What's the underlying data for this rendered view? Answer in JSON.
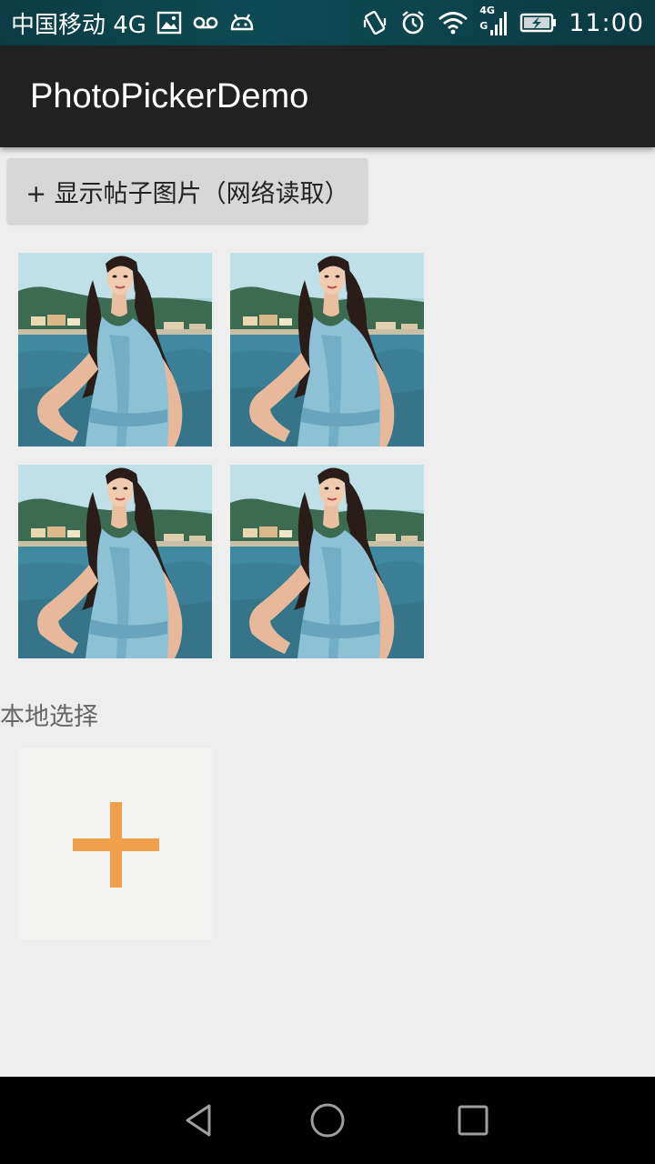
{
  "status_bar": {
    "carrier": "中国移动 4G",
    "network_top": "4G",
    "network_bottom": "G",
    "time": "11:00",
    "icons": [
      "image-icon",
      "voicemail-icon",
      "android-icon",
      "vibrate-icon",
      "alarm-icon",
      "wifi-icon",
      "signal-icon",
      "battery-charging-icon"
    ]
  },
  "app_bar": {
    "title": "PhotoPickerDemo"
  },
  "main": {
    "network_button_label": "+ 显示帖子图片（网络读取）",
    "photos_count": 4,
    "local_section_label": "本地选择",
    "add_icon": "plus-icon",
    "add_color": "#f0a04b"
  },
  "nav_bar": {
    "icons": [
      "back-icon",
      "home-icon",
      "recents-icon"
    ]
  }
}
